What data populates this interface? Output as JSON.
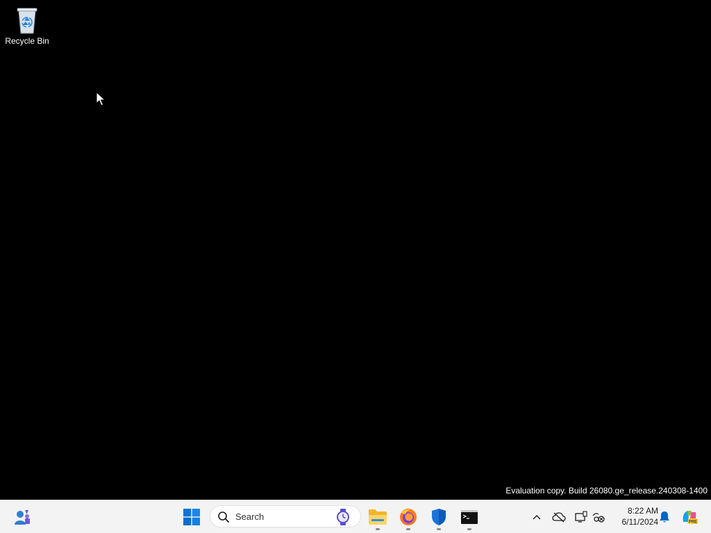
{
  "desktop": {
    "icons": [
      {
        "label": "Recycle Bin",
        "icon": "recycle-bin-icon"
      }
    ],
    "watermark": "Evaluation copy. Build 26080.ge_release.240308-1400"
  },
  "taskbar": {
    "widgets": {
      "icon": "widgets-icon"
    },
    "start": {
      "icon": "windows-logo-icon"
    },
    "search": {
      "placeholder": "Search",
      "icon": "search-icon",
      "badge_icon": "search-highlight-icon"
    },
    "apps": [
      {
        "name": "File Explorer",
        "icon": "folder-icon",
        "running": true
      },
      {
        "name": "Firefox",
        "icon": "firefox-icon",
        "running": true
      },
      {
        "name": "Windows Security",
        "icon": "shield-icon",
        "running": true
      },
      {
        "name": "Command Prompt",
        "icon": "terminal-icon",
        "running": true
      }
    ]
  },
  "tray": {
    "icons": [
      "chevron-up-icon",
      "cloud-offline-icon",
      "display-icon",
      "network-icon",
      "bell-icon",
      "copilot-icon"
    ],
    "time": "8:22 AM",
    "date": "6/11/2024"
  },
  "colors": {
    "taskbar_bg": "#f3f3f3",
    "desktop_bg": "#000000",
    "accent": "#0067c0"
  }
}
